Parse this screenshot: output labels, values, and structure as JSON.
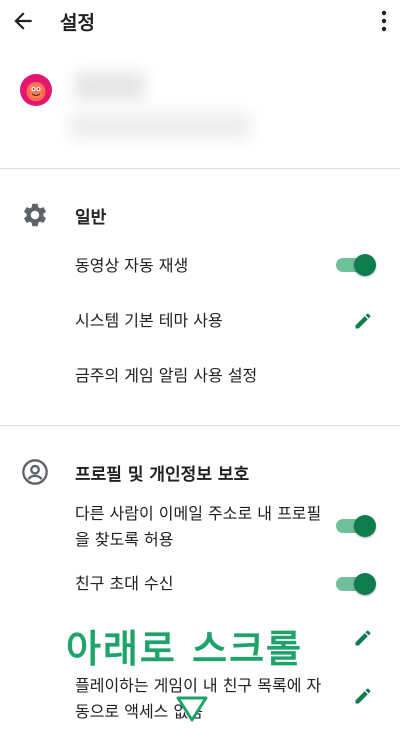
{
  "app_bar": {
    "title": "설정",
    "back_icon": "arrow-back-icon",
    "more_icon": "more-vert-icon"
  },
  "account": {
    "avatar_icon": "profile-avatar-icon"
  },
  "sections": {
    "general": {
      "title": "일반",
      "icon": "gear-icon",
      "items": [
        {
          "label": "동영상 자동 재생",
          "control": "toggle",
          "state": true
        },
        {
          "label": "시스템 기본 테마 사용",
          "control": "edit"
        },
        {
          "label": "금주의 게임 알림 사용 설정",
          "control": "none"
        }
      ]
    },
    "privacy": {
      "title": "프로필 및 개인정보 보호",
      "icon": "account-circle-icon",
      "items": [
        {
          "label": "다른 사람이 이메일 주소로 내 프로필을 찾도록 허용",
          "control": "toggle",
          "state": true
        },
        {
          "label": "친구 초대 수신",
          "control": "toggle",
          "state": true
        },
        {
          "label": "",
          "control": "edit"
        },
        {
          "label": "플레이하는 게임이 내 친구 목록에 자동으로 액세스 없음",
          "control": "edit"
        }
      ]
    }
  },
  "overlay": {
    "text": "아래로 스크롤",
    "arrow_icon": "triangle-down-icon"
  },
  "colors": {
    "accent": "#0d7d4d",
    "track": "#6fbf9a",
    "overlay": "#1ea36b"
  }
}
